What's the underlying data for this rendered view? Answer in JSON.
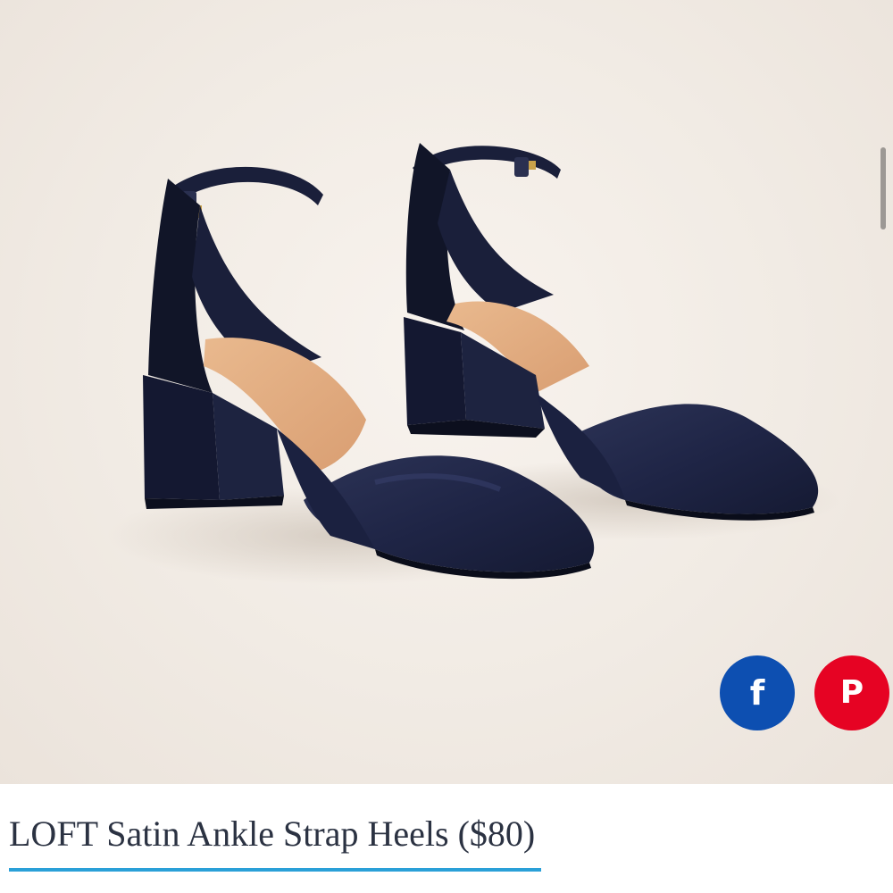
{
  "product": {
    "image_alt": "LOFT Satin Ankle Strap Heels",
    "color_hex": "#1e2444"
  },
  "share": {
    "facebook_glyph": "f",
    "pinterest_glyph": "P",
    "facebook_color": "#0d4fb1",
    "pinterest_color": "#e60323"
  },
  "caption": {
    "title": "LOFT Satin Ankle Strap Heels",
    "price": "($80)",
    "underline_color": "#2aa0d8"
  }
}
